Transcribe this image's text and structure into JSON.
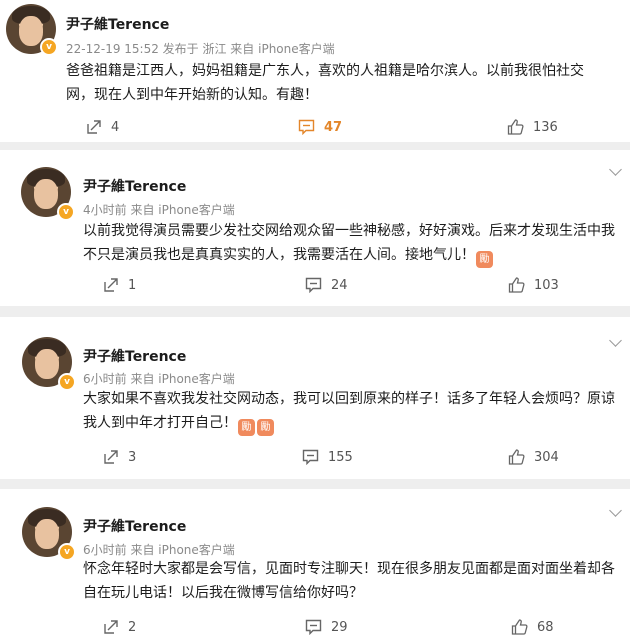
{
  "posts": [
    {
      "author": "尹子維Terence",
      "meta": "22-12-19 15:52 发布于 浙江  来自 iPhone客户端",
      "lines": [
        "爸爸祖籍是江西人，妈妈祖籍是广东人，喜欢的人祖籍是哈尔滨人。以前我很怕社交",
        "网，现在人到中年开始新的认知。有趣！"
      ],
      "reposts": "4",
      "comments": "47",
      "likes": "136"
    },
    {
      "author": "尹子維Terence",
      "meta": "4小时前  来自 iPhone客户端",
      "lines": [
        "以前我觉得演员需要少发社交网给观众留一些神秘感，好好演戏。后来才发现生活中我",
        "不只是演员我也是真真实实的人，我需要活在人间。接地气儿！"
      ],
      "emoji": [
        "勵"
      ],
      "reposts": "1",
      "comments": "24",
      "likes": "103"
    },
    {
      "author": "尹子維Terence",
      "meta": "6小时前  来自 iPhone客户端",
      "lines": [
        "大家如果不喜欢我发社交网动态，我可以回到原来的样子！话多了年轻人会烦吗？原谅",
        "我人到中年才打开自己！"
      ],
      "emoji": [
        "勵",
        "勵"
      ],
      "reposts": "3",
      "comments": "155",
      "likes": "304"
    },
    {
      "author": "尹子維Terence",
      "meta": "6小时前  来自 iPhone客户端",
      "lines": [
        "怀念年轻时大家都是会写信，见面时专注聊天！现在很多朋友见面都是面对面坐着却各",
        "自在玩儿电话！以后我在微博写信给你好吗？"
      ],
      "reposts": "2",
      "comments": "29",
      "likes": "68"
    }
  ],
  "icons": {
    "repost": "repost-icon",
    "comment": "comment-icon",
    "like": "like-icon",
    "more": "chevron-down-icon",
    "verified": "verified-badge-icon"
  },
  "colors": {
    "highlight": "#e3862a",
    "meta": "#8a8a8a",
    "badge": "#f5a623"
  }
}
